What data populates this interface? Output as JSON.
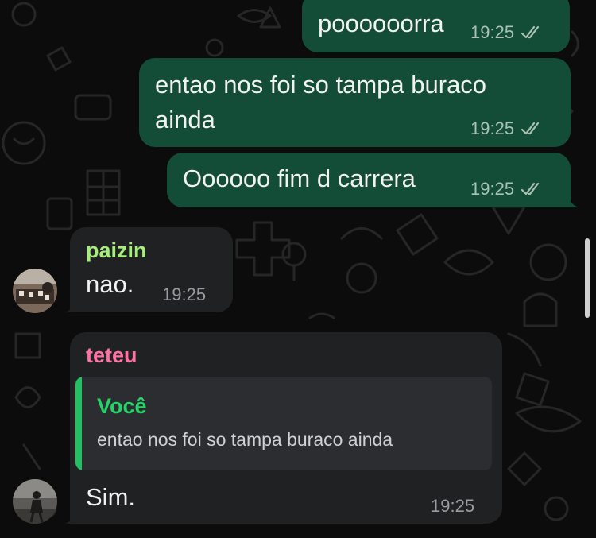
{
  "colors": {
    "outgoing_bubble": "#134d37",
    "incoming_bubble": "#1f2123",
    "sender_paizin": "#a7ef7d",
    "sender_teteu": "#ff72a1",
    "quote_author": "#25d366"
  },
  "messages": [
    {
      "direction": "outgoing",
      "text": "poooooorra",
      "time": "19:25",
      "status": "read-double-check"
    },
    {
      "direction": "outgoing",
      "lines": [
        "entao nos foi so tampa buraco",
        "ainda"
      ],
      "time": "19:25",
      "status": "read-double-check"
    },
    {
      "direction": "outgoing",
      "text": "Oooooo fim d carrera",
      "time": "19:25",
      "status": "read-double-check"
    },
    {
      "direction": "incoming",
      "sender": "paizin",
      "text": "nao.",
      "time": "19:25"
    },
    {
      "direction": "incoming",
      "sender": "teteu",
      "reply": {
        "author": "Você",
        "text": "entao nos foi so tampa buraco ainda"
      },
      "text": "Sim.",
      "time": "19:25"
    }
  ]
}
